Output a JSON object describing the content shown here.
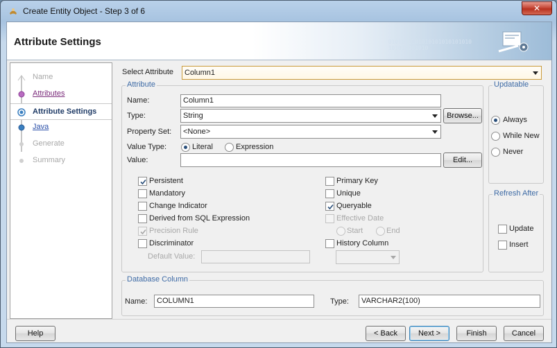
{
  "window": {
    "title": "Create Entity Object - Step 3 of 6",
    "close_glyph": "✕"
  },
  "header": {
    "title": "Attribute Settings",
    "binary": "0101010101010101010101010\n101010101010"
  },
  "nav": {
    "items": [
      {
        "label": "Name",
        "state": "disabled"
      },
      {
        "label": "Attributes",
        "state": "visited"
      },
      {
        "label": "Attribute Settings",
        "state": "current"
      },
      {
        "label": "Java",
        "state": "link"
      },
      {
        "label": "Generate",
        "state": "disabled"
      },
      {
        "label": "Summary",
        "state": "disabled"
      }
    ]
  },
  "select_attribute": {
    "label": "Select Attribute",
    "value": "Column1"
  },
  "attribute_group": {
    "title": "Attribute",
    "name_label": "Name:",
    "name_value": "Column1",
    "type_label": "Type:",
    "type_value": "String",
    "browse_label": "Browse...",
    "property_set_label": "Property Set:",
    "property_set_value": "<None>",
    "value_type_label": "Value Type:",
    "value_type_options": [
      "Literal",
      "Expression"
    ],
    "value_label": "Value:",
    "value_value": "",
    "edit_label": "Edit...",
    "checkboxes_left": [
      {
        "label": "Persistent",
        "checked": true,
        "disabled": false
      },
      {
        "label": "Mandatory",
        "checked": false,
        "disabled": false
      },
      {
        "label": "Change Indicator",
        "checked": false,
        "disabled": false
      },
      {
        "label": "Derived from SQL Expression",
        "checked": false,
        "disabled": false
      },
      {
        "label": "Precision Rule",
        "checked": true,
        "disabled": true
      },
      {
        "label": "Discriminator",
        "checked": false,
        "disabled": false
      }
    ],
    "checkboxes_right": [
      {
        "label": "Primary Key",
        "checked": false,
        "disabled": false
      },
      {
        "label": "Unique",
        "checked": false,
        "disabled": false
      },
      {
        "label": "Queryable",
        "checked": true,
        "disabled": false
      },
      {
        "label": "Effective Date",
        "checked": false,
        "disabled": true
      },
      {
        "label": "History Column",
        "checked": false,
        "disabled": false
      }
    ],
    "effective_date_options": [
      "Start",
      "End"
    ],
    "default_value_label": "Default Value:",
    "default_value": ""
  },
  "updatable_group": {
    "title": "Updatable",
    "options": [
      "Always",
      "While New",
      "Never"
    ],
    "selected": "Always"
  },
  "refresh_group": {
    "title": "Refresh After",
    "options": [
      "Update",
      "Insert"
    ]
  },
  "database_column": {
    "title": "Database Column",
    "name_label": "Name:",
    "name_value": "COLUMN1",
    "type_label": "Type:",
    "type_value": "VARCHAR2(100)"
  },
  "buttons": {
    "help": "Help",
    "back": "< Back",
    "next": "Next >",
    "finish": "Finish",
    "cancel": "Cancel"
  }
}
